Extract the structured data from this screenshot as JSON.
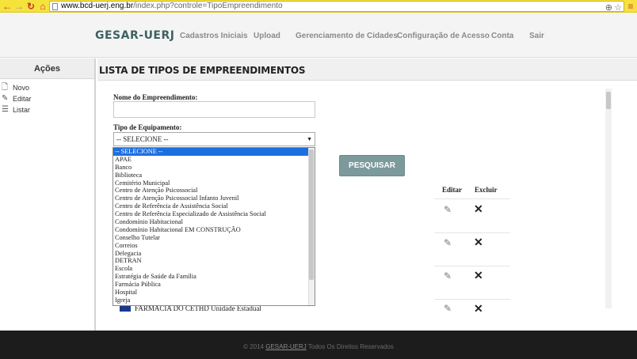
{
  "browser": {
    "url_domain": "www.bcd-uerj.eng.br",
    "url_path": "/index.php?controle=TipoEmpreendimento"
  },
  "header": {
    "brand": "GESAR-UERJ",
    "nav": [
      {
        "label": "Cadastros Iniciais"
      },
      {
        "label": "Upload"
      },
      {
        "label": "Gerenciamento de Cidades"
      },
      {
        "label": "Configuração de Acesso"
      },
      {
        "label": "Conta"
      },
      {
        "label": "Sair"
      }
    ]
  },
  "sidebar": {
    "title": "Ações",
    "items": [
      {
        "label": "Novo",
        "icon": "new-doc-icon"
      },
      {
        "label": "Editar",
        "icon": "pencil-icon"
      },
      {
        "label": "Listar",
        "icon": "list-icon"
      }
    ]
  },
  "main": {
    "title": "LISTA DE TIPOS DE EMPREENDIMENTOS",
    "name_label": "Nome do Empreendimento:",
    "name_value": "",
    "equip_label": "Tipo de Equipamento:",
    "equip_selected": "-- SELECIONE --",
    "search_button": "PESQUISAR",
    "col_edit": "Editar",
    "col_delete": "Excluir",
    "partial_row_text": "FARMÁCIA DO CETHD Unidade Estadual"
  },
  "dropdown": {
    "options": [
      "-- SELECIONE --",
      "APAE",
      "Banco",
      "Biblioteca",
      "Cemitério Municipal",
      "Centro de Atenção Psicossocial",
      "Centro de Atenção Psicossocial Infanto Juvenil",
      "Centro de Referência de Assistência Social",
      "Centro de Referência Especializado de Assistência Social",
      "Condomínio Habitacional",
      "Condomínio Habitacional EM CONSTRUÇÃO",
      "Conselho Tutelar",
      "Correios",
      "Delegacia",
      "DETRAN",
      "Escola",
      "Estratégia de Saúde da Família",
      "Farmácia Pública",
      "Hospital",
      "Igreja"
    ],
    "selected_index": 0
  },
  "footer": {
    "prefix": "© 2014",
    "link": "GESAR-UERJ",
    "suffix": "Todos Os Direitos Reservados"
  },
  "colors": {
    "browser_bar": "#f5e23a",
    "brand": "#3e6163",
    "button": "#7c9a9c",
    "selected_option": "#1d6fe0",
    "footer": "#1c1c1c"
  }
}
